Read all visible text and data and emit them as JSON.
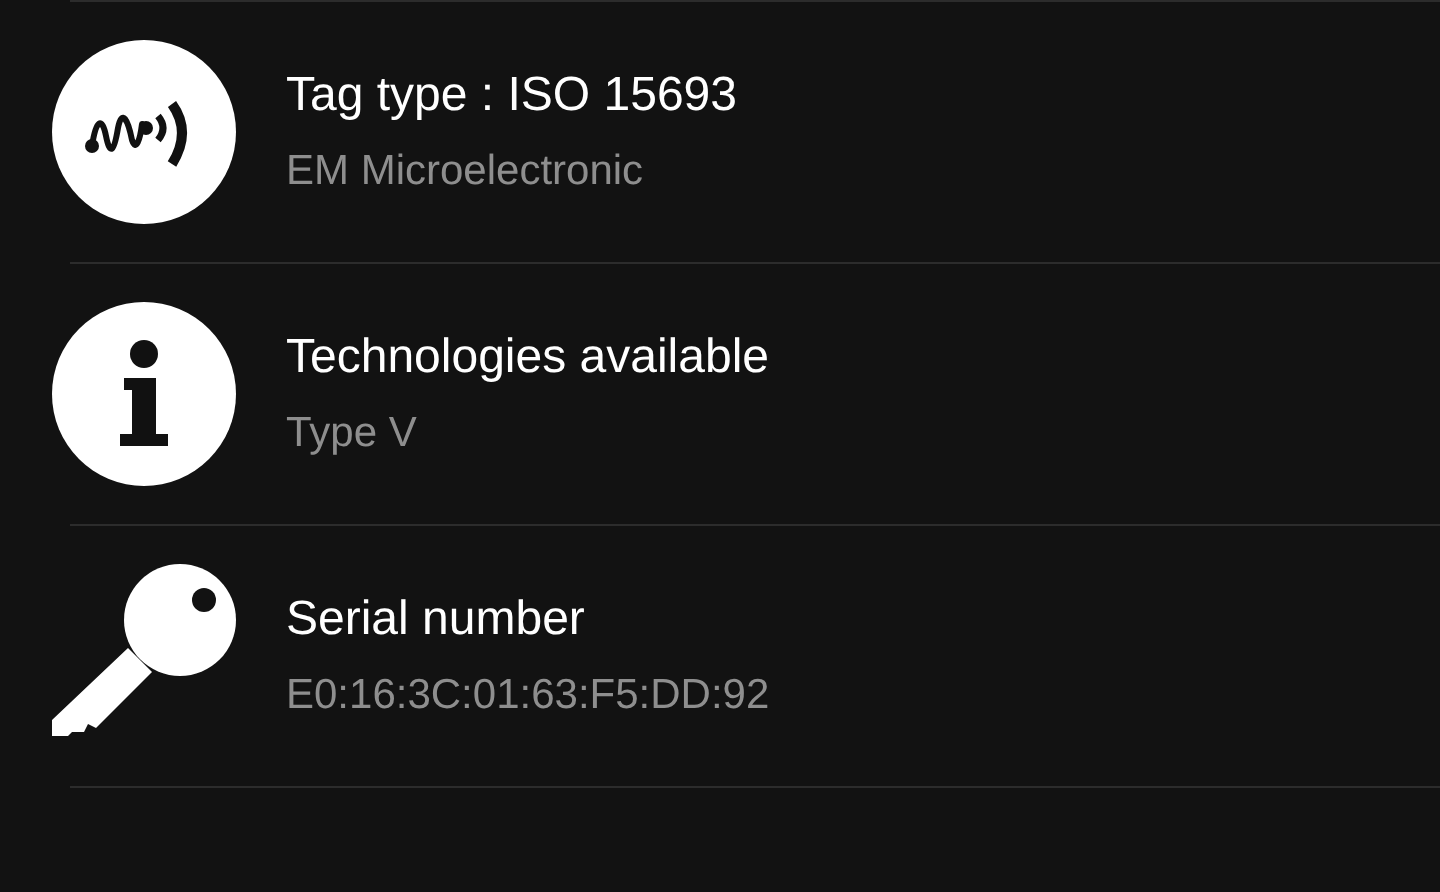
{
  "rows": [
    {
      "kind": "nfc",
      "title": "Tag type : ISO 15693",
      "subtitle": "EM Microelectronic"
    },
    {
      "kind": "info",
      "title": "Technologies available",
      "subtitle": "Type V"
    },
    {
      "kind": "key",
      "title": "Serial number",
      "subtitle": "E0:16:3C:01:63:F5:DD:92"
    }
  ]
}
